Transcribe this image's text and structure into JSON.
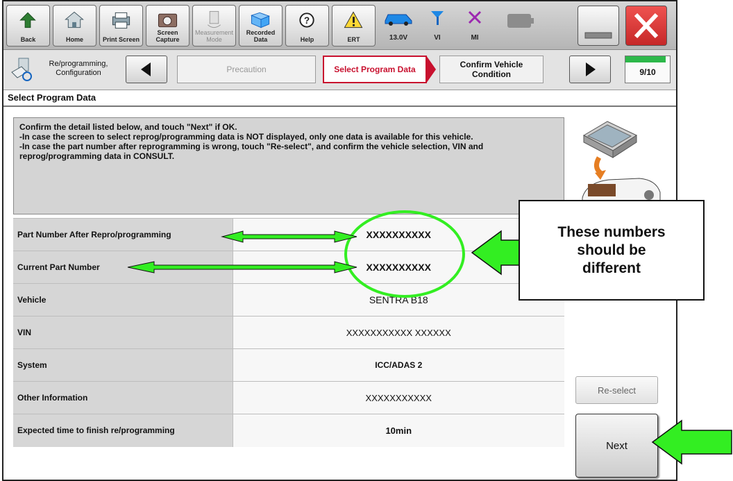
{
  "toolbar": {
    "back": "Back",
    "home": "Home",
    "print_screen": "Print Screen",
    "screen_capture": "Screen Capture",
    "measurement_mode": "Measurement Mode",
    "recorded_data": "Recorded Data",
    "help": "Help",
    "ert": "ERT",
    "battery_voltage": "13.0V",
    "vi": "VI",
    "mi": "MI"
  },
  "steps": {
    "section": "Re/programming, Configuration",
    "previous": "Precaution",
    "current": "Select Program Data",
    "next": "Confirm Vehicle Condition",
    "progress": "9/10",
    "progress_fraction": 0.9
  },
  "page_title": "Select Program Data",
  "instructions": "Confirm the detail listed below, and touch \"Next\" if OK.\n-In case the screen to select reprog/programming data is NOT displayed, only one data is available for this vehicle.\n-In case the part number after reprogramming is wrong, touch \"Re-select\", and confirm the vehicle selection, VIN and reprog/programming data in CONSULT.",
  "table": {
    "rows": [
      {
        "label": "Part Number After Repro/programming",
        "value": "XXXXXXXXXX"
      },
      {
        "label": "Current Part Number",
        "value": "XXXXXXXXXX"
      },
      {
        "label": "Vehicle",
        "value": "SENTRA B18"
      },
      {
        "label": "VIN",
        "value": "XXXXXXXXXXX XXXXXX"
      },
      {
        "label": "System",
        "value": "ICC/ADAS 2"
      },
      {
        "label": "Other Information",
        "value": "XXXXXXXXXXX"
      },
      {
        "label": "Expected time to finish re/programming",
        "value": "10min"
      }
    ]
  },
  "buttons": {
    "reselect": "Re-select",
    "next": "Next"
  },
  "callout": "These numbers\nshould be\ndifferent",
  "colors": {
    "annotation_green": "#33ee22",
    "current_step_red": "#c8102e",
    "progress_green": "#2db84a"
  }
}
